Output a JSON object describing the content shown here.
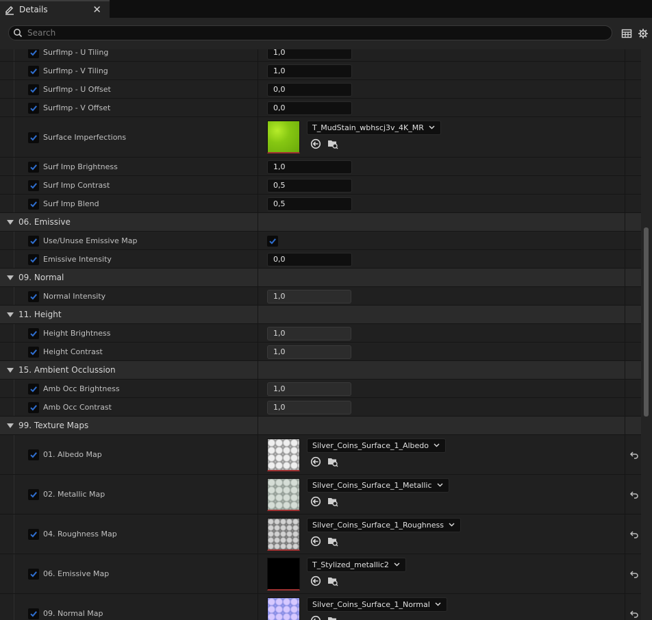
{
  "tab": {
    "title": "Details",
    "close": "✕"
  },
  "search": {
    "placeholder": "Search",
    "value": ""
  },
  "icons": {
    "tab": "pencil-icon",
    "search": "search-icon",
    "table": "table-view-icon",
    "settings": "gear-icon",
    "use_asset": "use-selected-asset-icon",
    "browse": "browse-folder-icon",
    "reset": "reset-to-default-icon",
    "checkmark": "checkmark-icon",
    "expander": "triangle-down-icon",
    "combo_arrow": "chevron-down-icon"
  },
  "colors": {
    "checkmark": "#2f6fd1",
    "panel": "#242424",
    "row": "#202020",
    "category": "#2b2b2b"
  },
  "rows": [
    {
      "kind": "num",
      "label": "SurfImp - U Tiling",
      "value": "1,0"
    },
    {
      "kind": "num",
      "label": "SurfImp - V Tiling",
      "value": "1,0"
    },
    {
      "kind": "num",
      "label": "SurfImp - U Offset",
      "value": "0,0"
    },
    {
      "kind": "num",
      "label": "SurfImp - V Offset",
      "value": "0,0"
    },
    {
      "kind": "texture",
      "label": "Surface Imperfections",
      "asset": "T_MudStain_wbhscj3v_4K_MR",
      "thumb": "mud",
      "reset": false
    },
    {
      "kind": "num",
      "label": "Surf Imp Brightness",
      "value": "1,0"
    },
    {
      "kind": "num",
      "label": "Surf Imp Contrast",
      "value": "0,5"
    },
    {
      "kind": "num",
      "label": "Surf Imp Blend",
      "value": "0,5"
    },
    {
      "kind": "category",
      "label": "06. Emissive"
    },
    {
      "kind": "bool",
      "label": "Use/Unuse Emissive Map",
      "checked": true
    },
    {
      "kind": "num",
      "label": "Emissive Intensity",
      "value": "0,0"
    },
    {
      "kind": "category",
      "label": "09. Normal"
    },
    {
      "kind": "num",
      "label": "Normal Intensity",
      "value": "1,0",
      "disabled": true
    },
    {
      "kind": "category",
      "label": "11. Height"
    },
    {
      "kind": "num",
      "label": "Height Brightness",
      "value": "1,0",
      "disabled": true
    },
    {
      "kind": "num",
      "label": "Height Contrast",
      "value": "1,0",
      "disabled": true
    },
    {
      "kind": "category",
      "label": "15. Ambient Occlussion"
    },
    {
      "kind": "num",
      "label": "Amb Occ Brightness",
      "value": "1,0",
      "disabled": true
    },
    {
      "kind": "num",
      "label": "Amb Occ Contrast",
      "value": "1,0",
      "disabled": true
    },
    {
      "kind": "category",
      "label": "99. Texture Maps"
    },
    {
      "kind": "texture",
      "label": "01. Albedo Map",
      "asset": "Silver_Coins_Surface_1_Albedo",
      "thumb": "silver",
      "reset": true
    },
    {
      "kind": "texture",
      "label": "02. Metallic Map",
      "asset": "Silver_Coins_Surface_1_Metallic",
      "thumb": "metal",
      "reset": true
    },
    {
      "kind": "texture",
      "label": "04. Roughness Map",
      "asset": "Silver_Coins_Surface_1_Roughness",
      "thumb": "rough",
      "reset": true
    },
    {
      "kind": "texture",
      "label": "06. Emissive Map",
      "asset": "T_Stylized_metallic2",
      "thumb": "black",
      "reset": true
    },
    {
      "kind": "texture",
      "label": "09. Normal Map",
      "asset": "Silver_Coins_Surface_1_Normal",
      "thumb": "normal",
      "reset": true
    }
  ]
}
